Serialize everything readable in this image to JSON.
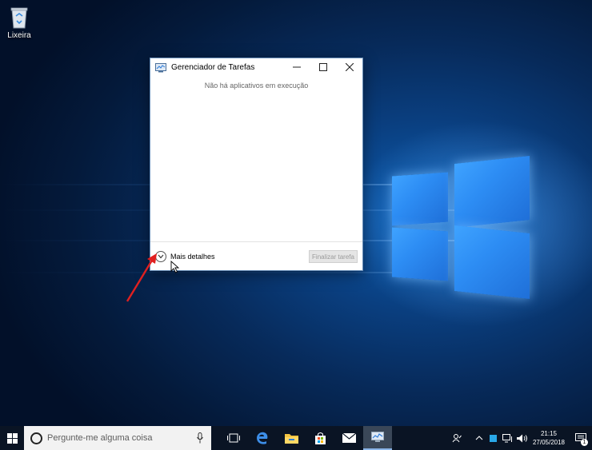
{
  "desktop": {
    "recycle_bin_label": "Lixeira",
    "recycle_bin_icon": "recycle-bin-icon"
  },
  "task_manager": {
    "title": "Gerenciador de Tarefas",
    "icon": "task-manager-icon",
    "empty_message": "Não há aplicativos em execução",
    "more_details_label": "Mais detalhes",
    "end_task_label": "Finalizar tarefa",
    "end_task_enabled": false
  },
  "taskbar": {
    "search_placeholder": "Pergunte-me alguma coisa",
    "pinned": [
      "task-view-icon",
      "edge-icon",
      "file-explorer-icon",
      "store-icon",
      "mail-icon",
      "task-manager-icon"
    ],
    "active_item": "task-manager-icon",
    "clock_time": "21:15",
    "clock_date": "27/05/2018",
    "notification_count": "1"
  },
  "colors": {
    "annotation_arrow": "#e02020",
    "taskbar_bg": "#0a1424",
    "desktop_accent": "#2d8df4"
  }
}
